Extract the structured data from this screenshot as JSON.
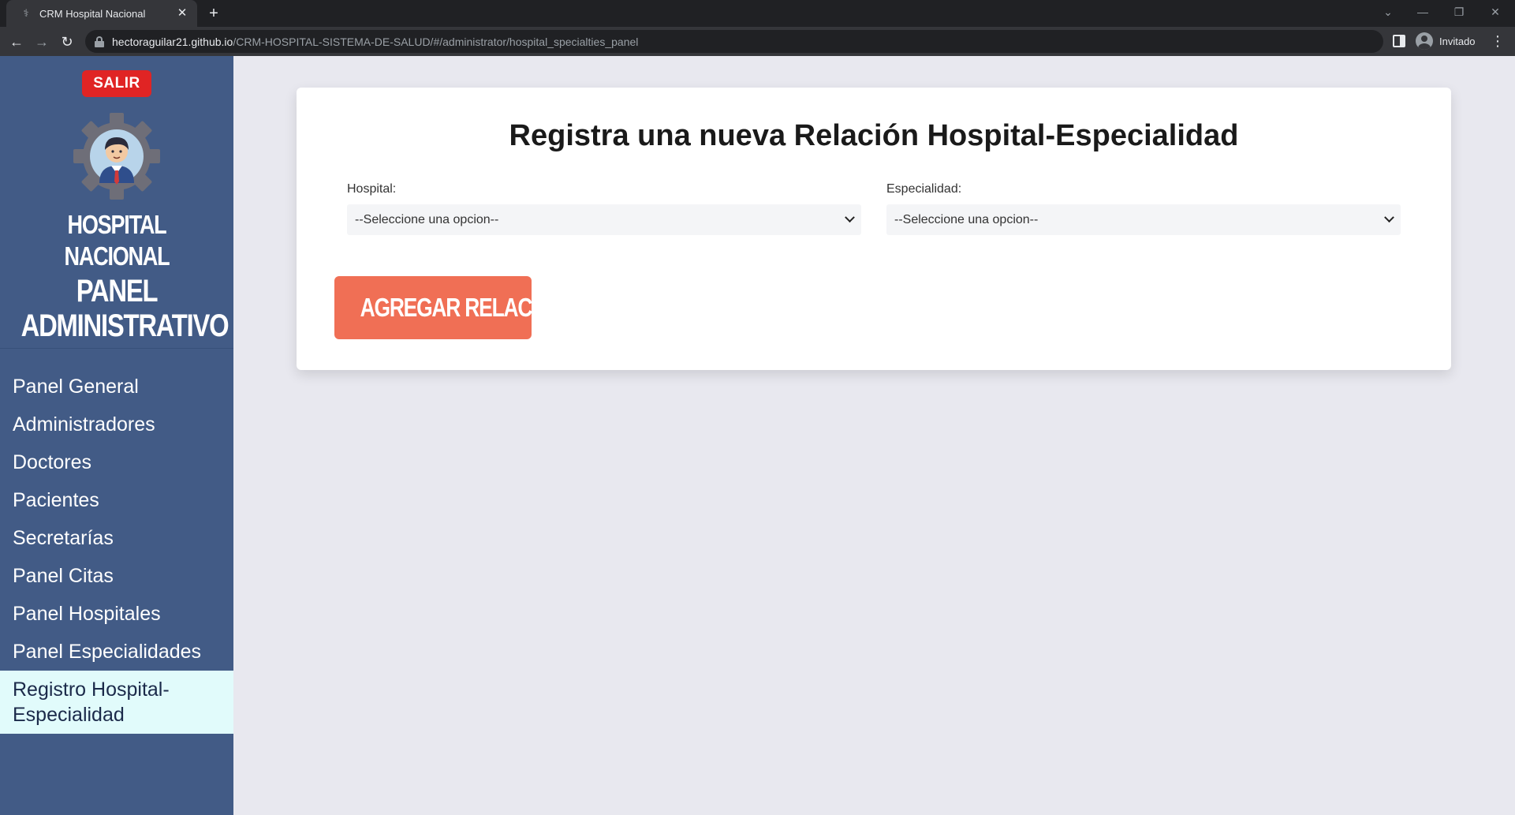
{
  "browser": {
    "tab_title": "CRM Hospital Nacional",
    "tab_close": "✕",
    "new_tab": "+",
    "url_host": "hectoraguilar21.github.io",
    "url_path": "/CRM-HOSPITAL-SISTEMA-DE-SALUD/#/administrator/hospital_specialties_panel",
    "profile_label": "Invitado"
  },
  "sidebar": {
    "logout_label": "SALIR",
    "brand": "HOSPITAL NACIONAL",
    "panel_line1": "PANEL",
    "panel_line2": "ADMINISTRATIVO",
    "items": [
      {
        "label": "Panel General"
      },
      {
        "label": "Administradores"
      },
      {
        "label": "Doctores"
      },
      {
        "label": "Pacientes"
      },
      {
        "label": "Secretarías"
      },
      {
        "label": "Panel Citas"
      },
      {
        "label": "Panel Hospitales"
      },
      {
        "label": "Panel Especialidades"
      },
      {
        "label": "Registro Hospital-Especialidad"
      }
    ],
    "active_index": 8
  },
  "form": {
    "title": "Registra una nueva Relación Hospital-Especialidad",
    "hospital_label": "Hospital:",
    "hospital_value": "--Seleccione una opcion--",
    "specialty_label": "Especialidad:",
    "specialty_value": "--Seleccione una opcion--",
    "submit_label": "AGREGAR RELACIÓN"
  },
  "colors": {
    "sidebar_bg": "#425b86",
    "active_item_bg": "#e1fbfb",
    "logout_bg": "#e02424",
    "submit_bg": "#f06f55",
    "main_bg": "#e8e8ef"
  }
}
